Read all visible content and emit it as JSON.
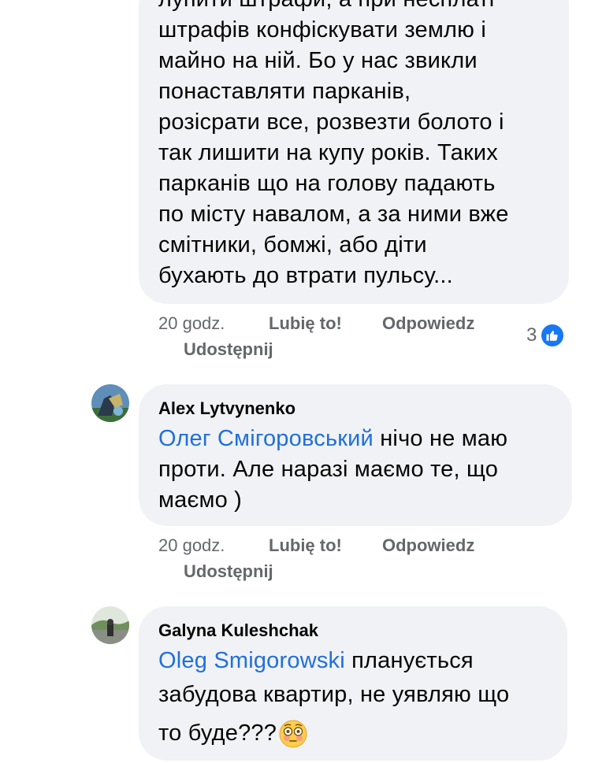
{
  "comments": [
    {
      "text_lines": [
        "лупити штрафи, а при несплаті",
        "штрафів конфіскувати землю і",
        "майно на ній. Бо у нас звикли",
        "понаставляти парканів,",
        "розісрати все, розвезти болото і",
        "так лишити на купу років. Таких",
        "парканів що на голову падають",
        "по місту навалом, а за ними вже",
        "смітники, бомжі, або діти",
        "бухають до втрати пульсу..."
      ],
      "time": "20 godz.",
      "like_label": "Lubię to!",
      "reply_label": "Odpowiedz",
      "share_label": "Udostępnij",
      "reaction_count": "3",
      "reaction_icon": "thumbs-up-icon"
    },
    {
      "author": "Alex Lytvynenko",
      "mention": "Олег Смігоровський",
      "text_first": " нічо не маю",
      "text_lines": [
        "проти. Але наразі маємо те, що",
        "маємо )"
      ],
      "time": "20 godz.",
      "like_label": "Lubię to!",
      "reply_label": "Odpowiedz",
      "share_label": "Udostępnij"
    },
    {
      "author": "Galyna Kuleshchak",
      "mention": "Oleg Smigorowski",
      "text_first": " планується",
      "text_lines": [
        "забудова квартир, не уявляю що"
      ],
      "text_last": "то буде???",
      "emoji": "flushed-face-icon"
    }
  ],
  "colors": {
    "bubble_bg": "#f0f2f5",
    "mention": "#216fdb",
    "meta": "#65676b",
    "like_blue": "#1877f2"
  }
}
